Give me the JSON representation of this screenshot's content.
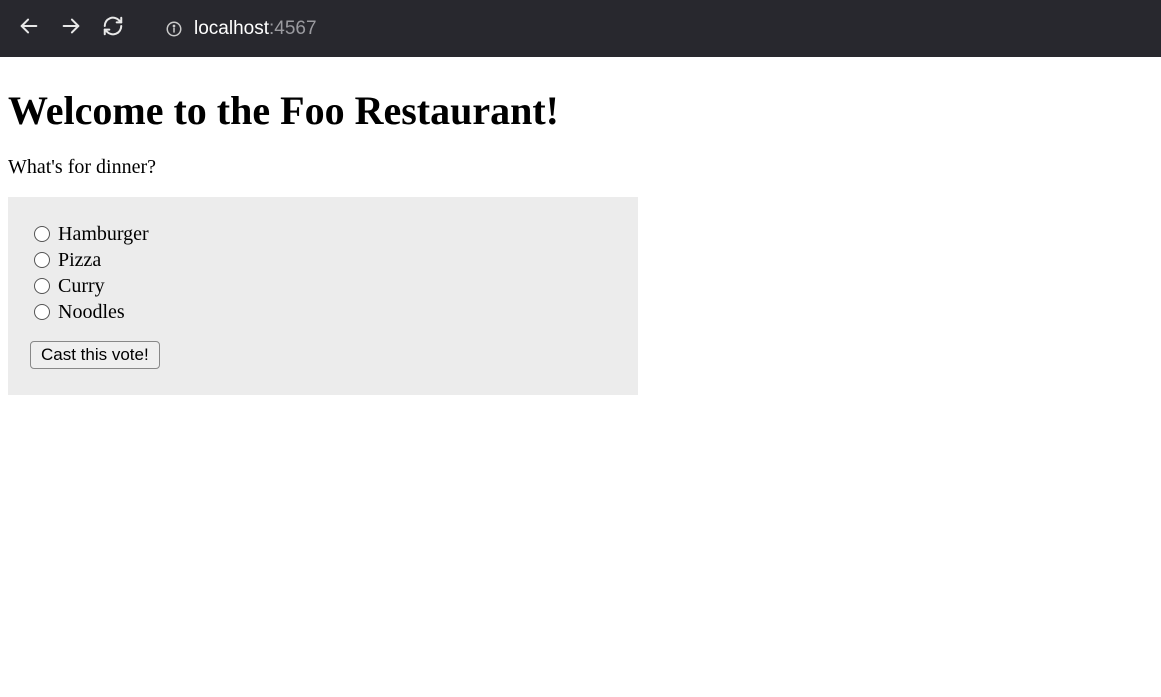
{
  "browser": {
    "url_host": "localhost",
    "url_port": ":4567"
  },
  "page": {
    "heading": "Welcome to the Foo Restaurant!",
    "question": "What's for dinner?",
    "options": [
      "Hamburger",
      "Pizza",
      "Curry",
      "Noodles"
    ],
    "submit_label": "Cast this vote!"
  }
}
